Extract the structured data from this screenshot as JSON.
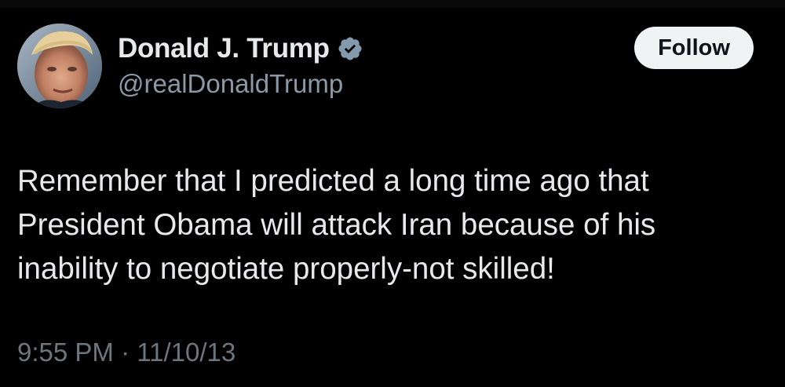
{
  "author": {
    "display_name": "Donald J. Trump",
    "handle": "@realDonaldTrump",
    "verified": true,
    "verified_icon": "verified-badge-icon",
    "avatar_icon": "profile-photo"
  },
  "actions": {
    "follow_label": "Follow"
  },
  "tweet": {
    "text": "Remember that I predicted a long time ago that\nPresident Obama will attack Iran because of his\ninability to negotiate properly-not skilled!",
    "time": "9:55 PM",
    "separator": " · ",
    "date": "11/10/13"
  },
  "colors": {
    "background": "#000000",
    "text_primary": "#e7e9ea",
    "text_secondary": "#8b98a5",
    "verified_badge": "#829aab",
    "follow_bg": "#eff3f4"
  }
}
